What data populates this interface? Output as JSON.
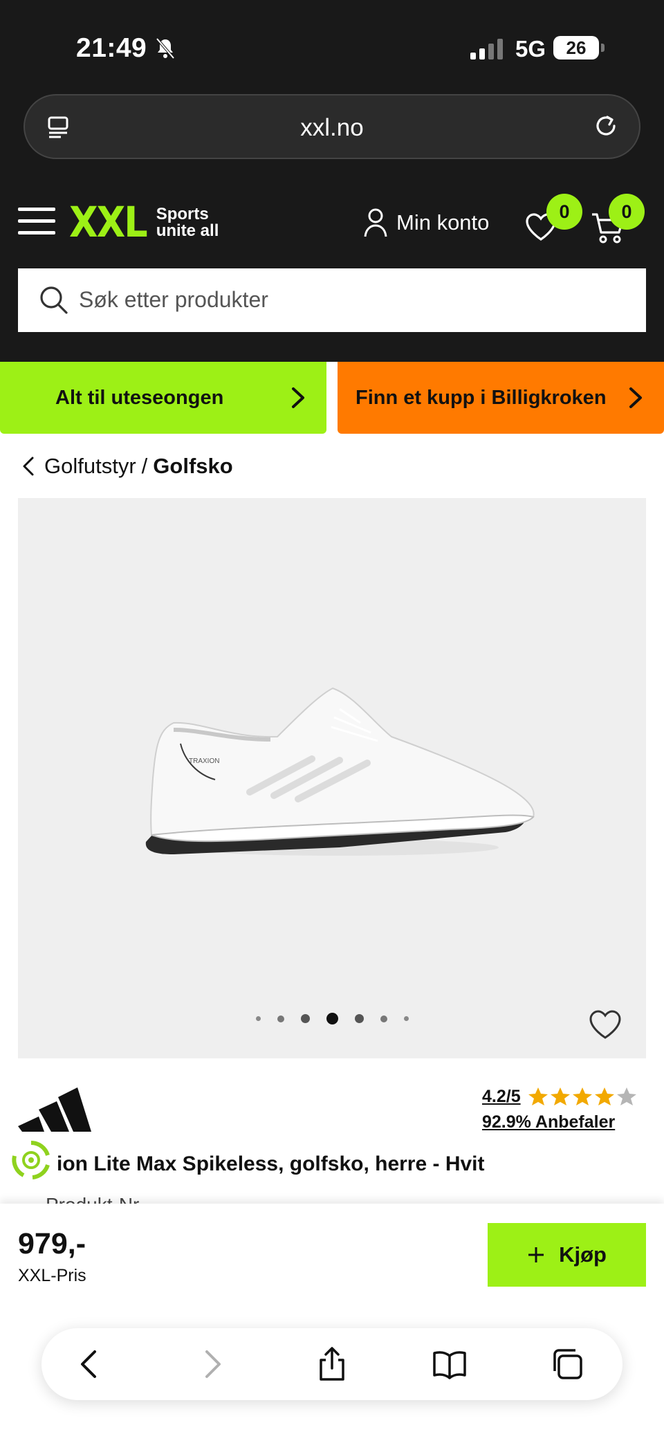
{
  "status_bar": {
    "time": "21:49",
    "network": "5G",
    "battery": "26"
  },
  "browser": {
    "url": "xxl.no"
  },
  "header": {
    "logo_mark": "XXL",
    "logo_tagline_1": "Sports",
    "logo_tagline_2": "unite all",
    "account_label": "Min konto",
    "wishlist_count": "0",
    "cart_count": "0",
    "search_placeholder": "Søk etter produkter"
  },
  "banners": {
    "green_label": "Alt til uteseongen",
    "orange_label": "Finn et kupp i Billigkroken"
  },
  "breadcrumb": {
    "parent": "Golfutstyr",
    "separator": "/",
    "current": "Golfsko"
  },
  "gallery": {
    "dot_count": 7,
    "active_index": 3
  },
  "product": {
    "rating_text": "4.2/5",
    "rating_value": 4.2,
    "rating_max": 5,
    "recommend_text": "92.9% Anbefaler",
    "title": "ion Lite Max Spikeless, golfsko, herre - Hvit",
    "subtitle_partial": "Produkt-Nr"
  },
  "sticky_bar": {
    "price": "979,-",
    "price_label": "XXL-Pris",
    "buy_label": "Kjøp"
  },
  "colors": {
    "brand_green": "#9df016",
    "accent_orange": "#ff7a00",
    "header_bg": "#191919"
  }
}
